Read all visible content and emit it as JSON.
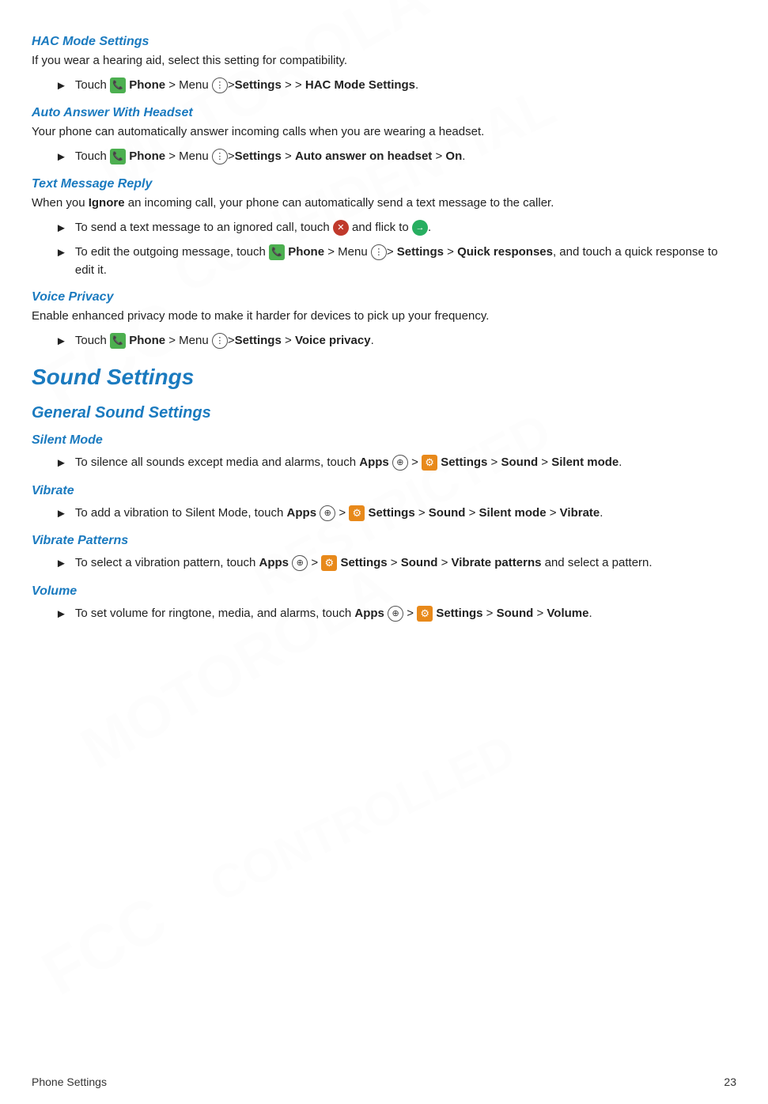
{
  "page": {
    "footer_left": "Phone Settings",
    "footer_page": "23"
  },
  "sections": [
    {
      "id": "hac-mode",
      "title": "HAC Mode Settings",
      "description": "If you wear a hearing aid, select this setting for compatibility.",
      "bullets": [
        {
          "type": "touch",
          "text": "Touch",
          "icon": "phone",
          "rest": " Phone > Menu ",
          "menu_icon": true,
          "bold_path": ">Settings > > HAC Mode Settings."
        }
      ]
    },
    {
      "id": "auto-answer",
      "title": "Auto Answer With Headset",
      "description": "Your phone can automatically answer incoming calls when you are wearing a headset.",
      "bullets": [
        {
          "type": "touch",
          "text": "Touch",
          "icon": "phone",
          "rest": " Phone > Menu ",
          "menu_icon": true,
          "bold_path": ">Settings > Auto answer on headset > On."
        }
      ]
    },
    {
      "id": "text-message-reply",
      "title": "Text Message Reply",
      "description1": "When you ",
      "description_bold": "Ignore",
      "description2": " an incoming call, your phone can automatically send a text message to the caller.",
      "bullets": [
        {
          "type": "flick",
          "text": "To send a text message to an ignored call, touch ",
          "icon1": "circle-red",
          "mid": " and flick to ",
          "icon2": "circle-green",
          "end": "."
        },
        {
          "type": "edit",
          "text": "To edit the outgoing message, touch ",
          "icon": "phone",
          "rest": " Phone > Menu ",
          "menu_icon": true,
          "bold_path": "> Settings > Quick responses",
          "end": ", and touch a quick response to edit it."
        }
      ]
    },
    {
      "id": "voice-privacy",
      "title": "Voice Privacy",
      "description": "Enable enhanced privacy mode to make it harder for devices to pick up your frequency.",
      "bullets": [
        {
          "type": "touch",
          "text": "Touch",
          "icon": "phone",
          "rest": " Phone > Menu ",
          "menu_icon": true,
          "bold_path": ">Settings > Voice privacy."
        }
      ]
    }
  ],
  "sound_settings": {
    "main_title": "Sound Settings",
    "sub_title": "General Sound Settings",
    "items": [
      {
        "id": "silent-mode",
        "title": "Silent Mode",
        "bullets": [
          {
            "text_pre": "To silence all sounds except media and alarms, touch ",
            "icon1": "apps",
            "mid1": " > ",
            "icon2": "settings",
            "bold_path": " Settings > Sound > Silent mode."
          }
        ]
      },
      {
        "id": "vibrate",
        "title": "Vibrate",
        "bullets": [
          {
            "text_pre": "To add a vibration to Silent Mode, touch ",
            "icon1": "apps",
            "mid1": " > ",
            "icon2": "settings",
            "bold_path": " Settings > Sound > Silent mode > Vibrate."
          }
        ]
      },
      {
        "id": "vibrate-patterns",
        "title": "Vibrate Patterns",
        "bullets": [
          {
            "text_pre": "To select a vibration pattern, touch ",
            "icon1": "apps",
            "mid1": " > ",
            "icon2": "settings",
            "bold_path": " Settings > Sound > Vibrate patterns",
            "end": " and select a pattern."
          }
        ]
      },
      {
        "id": "volume",
        "title": "Volume",
        "bullets": [
          {
            "text_pre": "To set volume for ringtone, media, and alarms, touch ",
            "icon1": "apps",
            "mid1": " > ",
            "icon2": "settings",
            "bold_path": " Settings > Sound > Volume."
          }
        ]
      }
    ]
  }
}
